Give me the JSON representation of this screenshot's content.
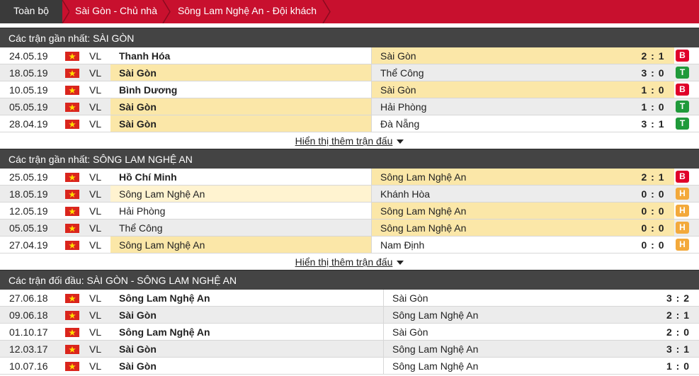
{
  "tabs": [
    {
      "label": "Toàn bộ"
    },
    {
      "label": "Sài Gòn - Chủ nhà"
    },
    {
      "label": "Sông Lam Nghệ An - Đội khách"
    }
  ],
  "colors": {
    "tab_bar": "#c8102e",
    "header": "#444444",
    "highlight": "#fbe7a8",
    "lose": "#e0002a",
    "win": "#1f9a3a",
    "draw": "#f3a93b"
  },
  "sections": [
    {
      "title": "Các trận gần nhất: SÀI GÒN",
      "more_label": "Hiển thị thêm trận đấu",
      "rows": [
        {
          "date": "24.05.19",
          "league": "VL",
          "home": "Thanh Hóa",
          "away": "Sài Gòn",
          "score": "2 : 1",
          "result": "B"
        },
        {
          "date": "18.05.19",
          "league": "VL",
          "home": "Sài Gòn",
          "away": "Thể Công",
          "score": "3 : 0",
          "result": "T"
        },
        {
          "date": "10.05.19",
          "league": "VL",
          "home": "Bình Dương",
          "away": "Sài Gòn",
          "score": "1 : 0",
          "result": "B"
        },
        {
          "date": "05.05.19",
          "league": "VL",
          "home": "Sài Gòn",
          "away": "Hải Phòng",
          "score": "1 : 0",
          "result": "T"
        },
        {
          "date": "28.04.19",
          "league": "VL",
          "home": "Sài Gòn",
          "away": "Đà Nẵng",
          "score": "3 : 1",
          "result": "T"
        }
      ]
    },
    {
      "title": "Các trận gần nhất: SÔNG LAM NGHỆ AN",
      "more_label": "Hiển thị thêm trận đấu",
      "rows": [
        {
          "date": "25.05.19",
          "league": "VL",
          "home": "Hồ Chí Minh",
          "away": "Sông Lam Nghệ An",
          "score": "2 : 1",
          "result": "B"
        },
        {
          "date": "18.05.19",
          "league": "VL",
          "home": "Sông Lam Nghệ An",
          "away": "Khánh Hòa",
          "score": "0 : 0",
          "result": "H"
        },
        {
          "date": "12.05.19",
          "league": "VL",
          "home": "Hải Phòng",
          "away": "Sông Lam Nghệ An",
          "score": "0 : 0",
          "result": "H"
        },
        {
          "date": "05.05.19",
          "league": "VL",
          "home": "Thể Công",
          "away": "Sông Lam Nghệ An",
          "score": "0 : 0",
          "result": "H"
        },
        {
          "date": "27.04.19",
          "league": "VL",
          "home": "Sông Lam Nghệ An",
          "away": "Nam Định",
          "score": "0 : 0",
          "result": "H"
        }
      ]
    },
    {
      "title": "Các trận đối đầu: SÀI GÒN - SÔNG LAM NGHỆ AN",
      "rows": [
        {
          "date": "27.06.18",
          "league": "VL",
          "home": "Sông Lam Nghệ An",
          "away": "Sài Gòn",
          "score": "3 : 2"
        },
        {
          "date": "09.06.18",
          "league": "VL",
          "home": "Sài Gòn",
          "away": "Sông Lam Nghệ An",
          "score": "2 : 1"
        },
        {
          "date": "01.10.17",
          "league": "VL",
          "home": "Sông Lam Nghệ An",
          "away": "Sài Gòn",
          "score": "2 : 0"
        },
        {
          "date": "12.03.17",
          "league": "VL",
          "home": "Sài Gòn",
          "away": "Sông Lam Nghệ An",
          "score": "3 : 1"
        },
        {
          "date": "10.07.16",
          "league": "VL",
          "home": "Sài Gòn",
          "away": "Sông Lam Nghệ An",
          "score": "1 : 0"
        }
      ]
    }
  ]
}
